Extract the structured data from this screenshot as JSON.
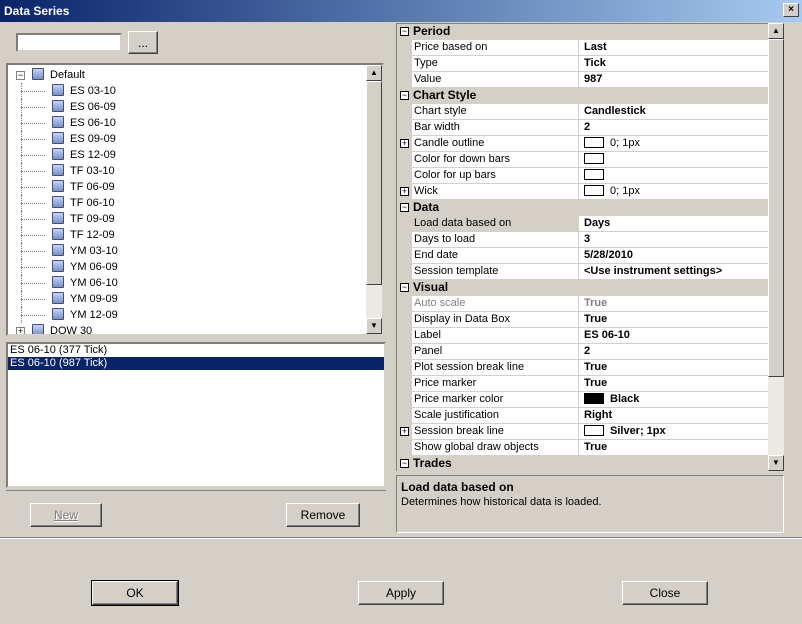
{
  "window": {
    "title": "Data Series",
    "close_glyph": "×"
  },
  "search": {
    "value": "",
    "browse_label": "..."
  },
  "tree": {
    "root_expander": "−",
    "root": "Default",
    "items": [
      "ES 03-10",
      "ES 06-09",
      "ES 06-10",
      "ES 09-09",
      "ES 12-09",
      "TF 03-10",
      "TF 06-09",
      "TF 06-10",
      "TF 09-09",
      "TF 12-09",
      "YM 03-10",
      "YM 06-09",
      "YM 06-10",
      "YM 09-09",
      "YM 12-09"
    ],
    "collapsed_expander": "+",
    "collapsed": "DOW 30"
  },
  "series": [
    {
      "label": "ES 06-10 (377 Tick)",
      "selected": false
    },
    {
      "label": "ES 06-10 (987 Tick)",
      "selected": true
    }
  ],
  "buttons": {
    "new": "New",
    "remove": "Remove",
    "ok": "OK",
    "apply": "Apply",
    "close": "Close"
  },
  "icons": {
    "up": "▲",
    "down": "▼",
    "collapse": "−",
    "expand": "+"
  },
  "properties": {
    "period": {
      "title": "Period",
      "rows": [
        {
          "name": "Price based on",
          "value": "Last"
        },
        {
          "name": "Type",
          "value": "Tick"
        },
        {
          "name": "Value",
          "value": "987"
        }
      ]
    },
    "chart_style": {
      "title": "Chart Style",
      "rows": [
        {
          "name": "Chart style",
          "value": "Candlestick"
        },
        {
          "name": "Bar width",
          "value": "2"
        },
        {
          "name": "Candle outline",
          "value": "0; 1px",
          "swatch": "#ffffff",
          "expandable": true
        },
        {
          "name": "Color for down bars",
          "value": "",
          "swatch": "#ffffff"
        },
        {
          "name": "Color for up bars",
          "value": "",
          "swatch": "#ffffff"
        },
        {
          "name": "Wick",
          "value": "0; 1px",
          "swatch": "#ffffff",
          "expandable": true
        }
      ]
    },
    "data": {
      "title": "Data",
      "rows": [
        {
          "name": "Load data based on",
          "value": "Days",
          "active": true
        },
        {
          "name": "Days to load",
          "value": "3"
        },
        {
          "name": "End date",
          "value": "5/28/2010"
        },
        {
          "name": "Session template",
          "value": "<Use instrument settings>"
        }
      ]
    },
    "visual": {
      "title": "Visual",
      "rows": [
        {
          "name": "Auto scale",
          "value": "True",
          "disabled": true
        },
        {
          "name": "Display in Data Box",
          "value": "True"
        },
        {
          "name": "Label",
          "value": "ES 06-10"
        },
        {
          "name": "Panel",
          "value": "2"
        },
        {
          "name": "Plot session break line",
          "value": "True"
        },
        {
          "name": "Price marker",
          "value": "True"
        },
        {
          "name": "Price marker color",
          "value": "Black",
          "swatch": "#000000"
        },
        {
          "name": "Scale justification",
          "value": "Right"
        },
        {
          "name": "Session break line",
          "value": "Silver; 1px",
          "swatch": "#ffffff",
          "expandable": true
        },
        {
          "name": "Show global draw objects",
          "value": "True"
        }
      ]
    },
    "trades": {
      "title": "Trades"
    }
  },
  "help": {
    "title": "Load data based on",
    "description": "Determines how historical data is loaded."
  },
  "colors": {
    "selection": "#0a246a",
    "face": "#d4d0c8"
  }
}
